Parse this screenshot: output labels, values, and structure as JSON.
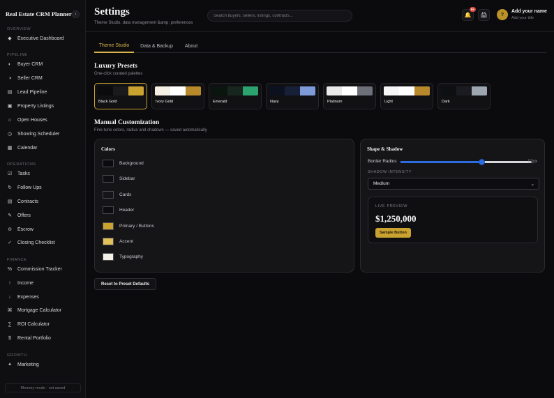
{
  "app": {
    "title": "Real Estate CRM Planner",
    "collapse_glyph": "‹"
  },
  "sidebar": {
    "sections": [
      {
        "label": "OVERVIEW"
      },
      {
        "label": "PIPELINE"
      },
      {
        "label": "OPERATIONS"
      },
      {
        "label": "FINANCE"
      },
      {
        "label": "GROWTH"
      }
    ],
    "items": [
      {
        "label": "Executive Dashboard",
        "icon": "diamond-icon",
        "glyph": "◆"
      },
      {
        "label": "Buyer CRM",
        "icon": "half-circle-icon",
        "glyph": "◐"
      },
      {
        "label": "Seller CRM",
        "icon": "half-circle-icon",
        "glyph": "◑"
      },
      {
        "label": "Lead Pipeline",
        "icon": "pipeline-icon",
        "glyph": "▤"
      },
      {
        "label": "Property Listings",
        "icon": "listing-icon",
        "glyph": "▣"
      },
      {
        "label": "Open Houses",
        "icon": "house-icon",
        "glyph": "⌂"
      },
      {
        "label": "Showing Scheduler",
        "icon": "clock-icon",
        "glyph": "◷"
      },
      {
        "label": "Calendar",
        "icon": "calendar-icon",
        "glyph": "▦"
      },
      {
        "label": "Tasks",
        "icon": "checkbox-icon",
        "glyph": "☑"
      },
      {
        "label": "Follow Ups",
        "icon": "refresh-icon",
        "glyph": "↻"
      },
      {
        "label": "Contracts",
        "icon": "document-icon",
        "glyph": "▤"
      },
      {
        "label": "Offers",
        "icon": "pen-icon",
        "glyph": "✎"
      },
      {
        "label": "Escrow",
        "icon": "escrow-icon",
        "glyph": "⊖"
      },
      {
        "label": "Closing Checklist",
        "icon": "check-icon",
        "glyph": "✓"
      },
      {
        "label": "Commission Tracker",
        "icon": "percent-icon",
        "glyph": "%"
      },
      {
        "label": "Income",
        "icon": "arrow-up-icon",
        "glyph": "↑"
      },
      {
        "label": "Expenses",
        "icon": "arrow-down-icon",
        "glyph": "↓"
      },
      {
        "label": "Mortgage Calculator",
        "icon": "mortgage-icon",
        "glyph": "⌘"
      },
      {
        "label": "ROI Calculator",
        "icon": "sigma-icon",
        "glyph": "∑"
      },
      {
        "label": "Rental Portfolio",
        "icon": "dollar-icon",
        "glyph": "$"
      },
      {
        "label": "Marketing",
        "icon": "sparkle-icon",
        "glyph": "✦"
      }
    ],
    "memory_note": "Memory mode · not saved"
  },
  "header": {
    "title": "Settings",
    "subtitle": "Theme Studio, data management &amp; preferences",
    "search_placeholder": "Search buyers, sellers, listings, contracts...",
    "notification_badge": "9+",
    "bell_glyph": "🔔",
    "print_glyph": "🖨",
    "avatar_initial": "?",
    "user_name": "Add your name",
    "user_title": "Add your title"
  },
  "tabs": [
    {
      "label": "Theme Studio",
      "active": true
    },
    {
      "label": "Data & Backup",
      "active": false
    },
    {
      "label": "About",
      "active": false
    }
  ],
  "presets_section": {
    "title": "Luxury Presets",
    "subtitle": "One-click curated palettes",
    "presets": [
      {
        "name": "Black Gold",
        "selected": true,
        "colors": [
          "#0b0b0d",
          "#1a1a1d",
          "#c9a230"
        ]
      },
      {
        "name": "Ivory Gold",
        "selected": false,
        "colors": [
          "#f3efe3",
          "#ffffff",
          "#b8892a"
        ]
      },
      {
        "name": "Emerald",
        "selected": false,
        "colors": [
          "#0b1510",
          "#17261e",
          "#2ca36e"
        ]
      },
      {
        "name": "Navy",
        "selected": false,
        "colors": [
          "#0c1120",
          "#172036",
          "#7f9ad8"
        ]
      },
      {
        "name": "Platinum",
        "selected": false,
        "colors": [
          "#e9e9ea",
          "#ffffff",
          "#6d7078"
        ]
      },
      {
        "name": "Light",
        "selected": false,
        "colors": [
          "#f6f6f6",
          "#ffffff",
          "#b8892a"
        ]
      },
      {
        "name": "Dark",
        "selected": false,
        "colors": [
          "#0e0f12",
          "#1a1c21",
          "#9ca6b1"
        ]
      }
    ]
  },
  "manual_section": {
    "title": "Manual Customization",
    "subtitle": "Fine-tune colors, radius and shadows — saved automatically"
  },
  "colors_panel": {
    "title": "Colors",
    "rows": [
      {
        "label": "Background",
        "color": "#0b0b0d"
      },
      {
        "label": "Sidebar",
        "color": "#0f0f11"
      },
      {
        "label": "Cards",
        "color": "#151518"
      },
      {
        "label": "Header",
        "color": "#0d0d10"
      },
      {
        "label": "Primary / Buttons",
        "color": "#c9a230"
      },
      {
        "label": "Accent",
        "color": "#e0c15a"
      },
      {
        "label": "Typography",
        "color": "#f4f1e8"
      }
    ]
  },
  "shape_panel": {
    "title": "Shape & Shadow",
    "border_radius_label": "Border Radius",
    "border_radius_value": "12px",
    "border_radius_fraction": 0.62,
    "shadow_label": "SHADOW INTENSITY",
    "shadow_value": "Medium",
    "preview_label": "LIVE PREVIEW",
    "preview_price": "$1,250,000",
    "sample_button": "Sample Button"
  },
  "reset_button": "Reset to Preset Defaults"
}
